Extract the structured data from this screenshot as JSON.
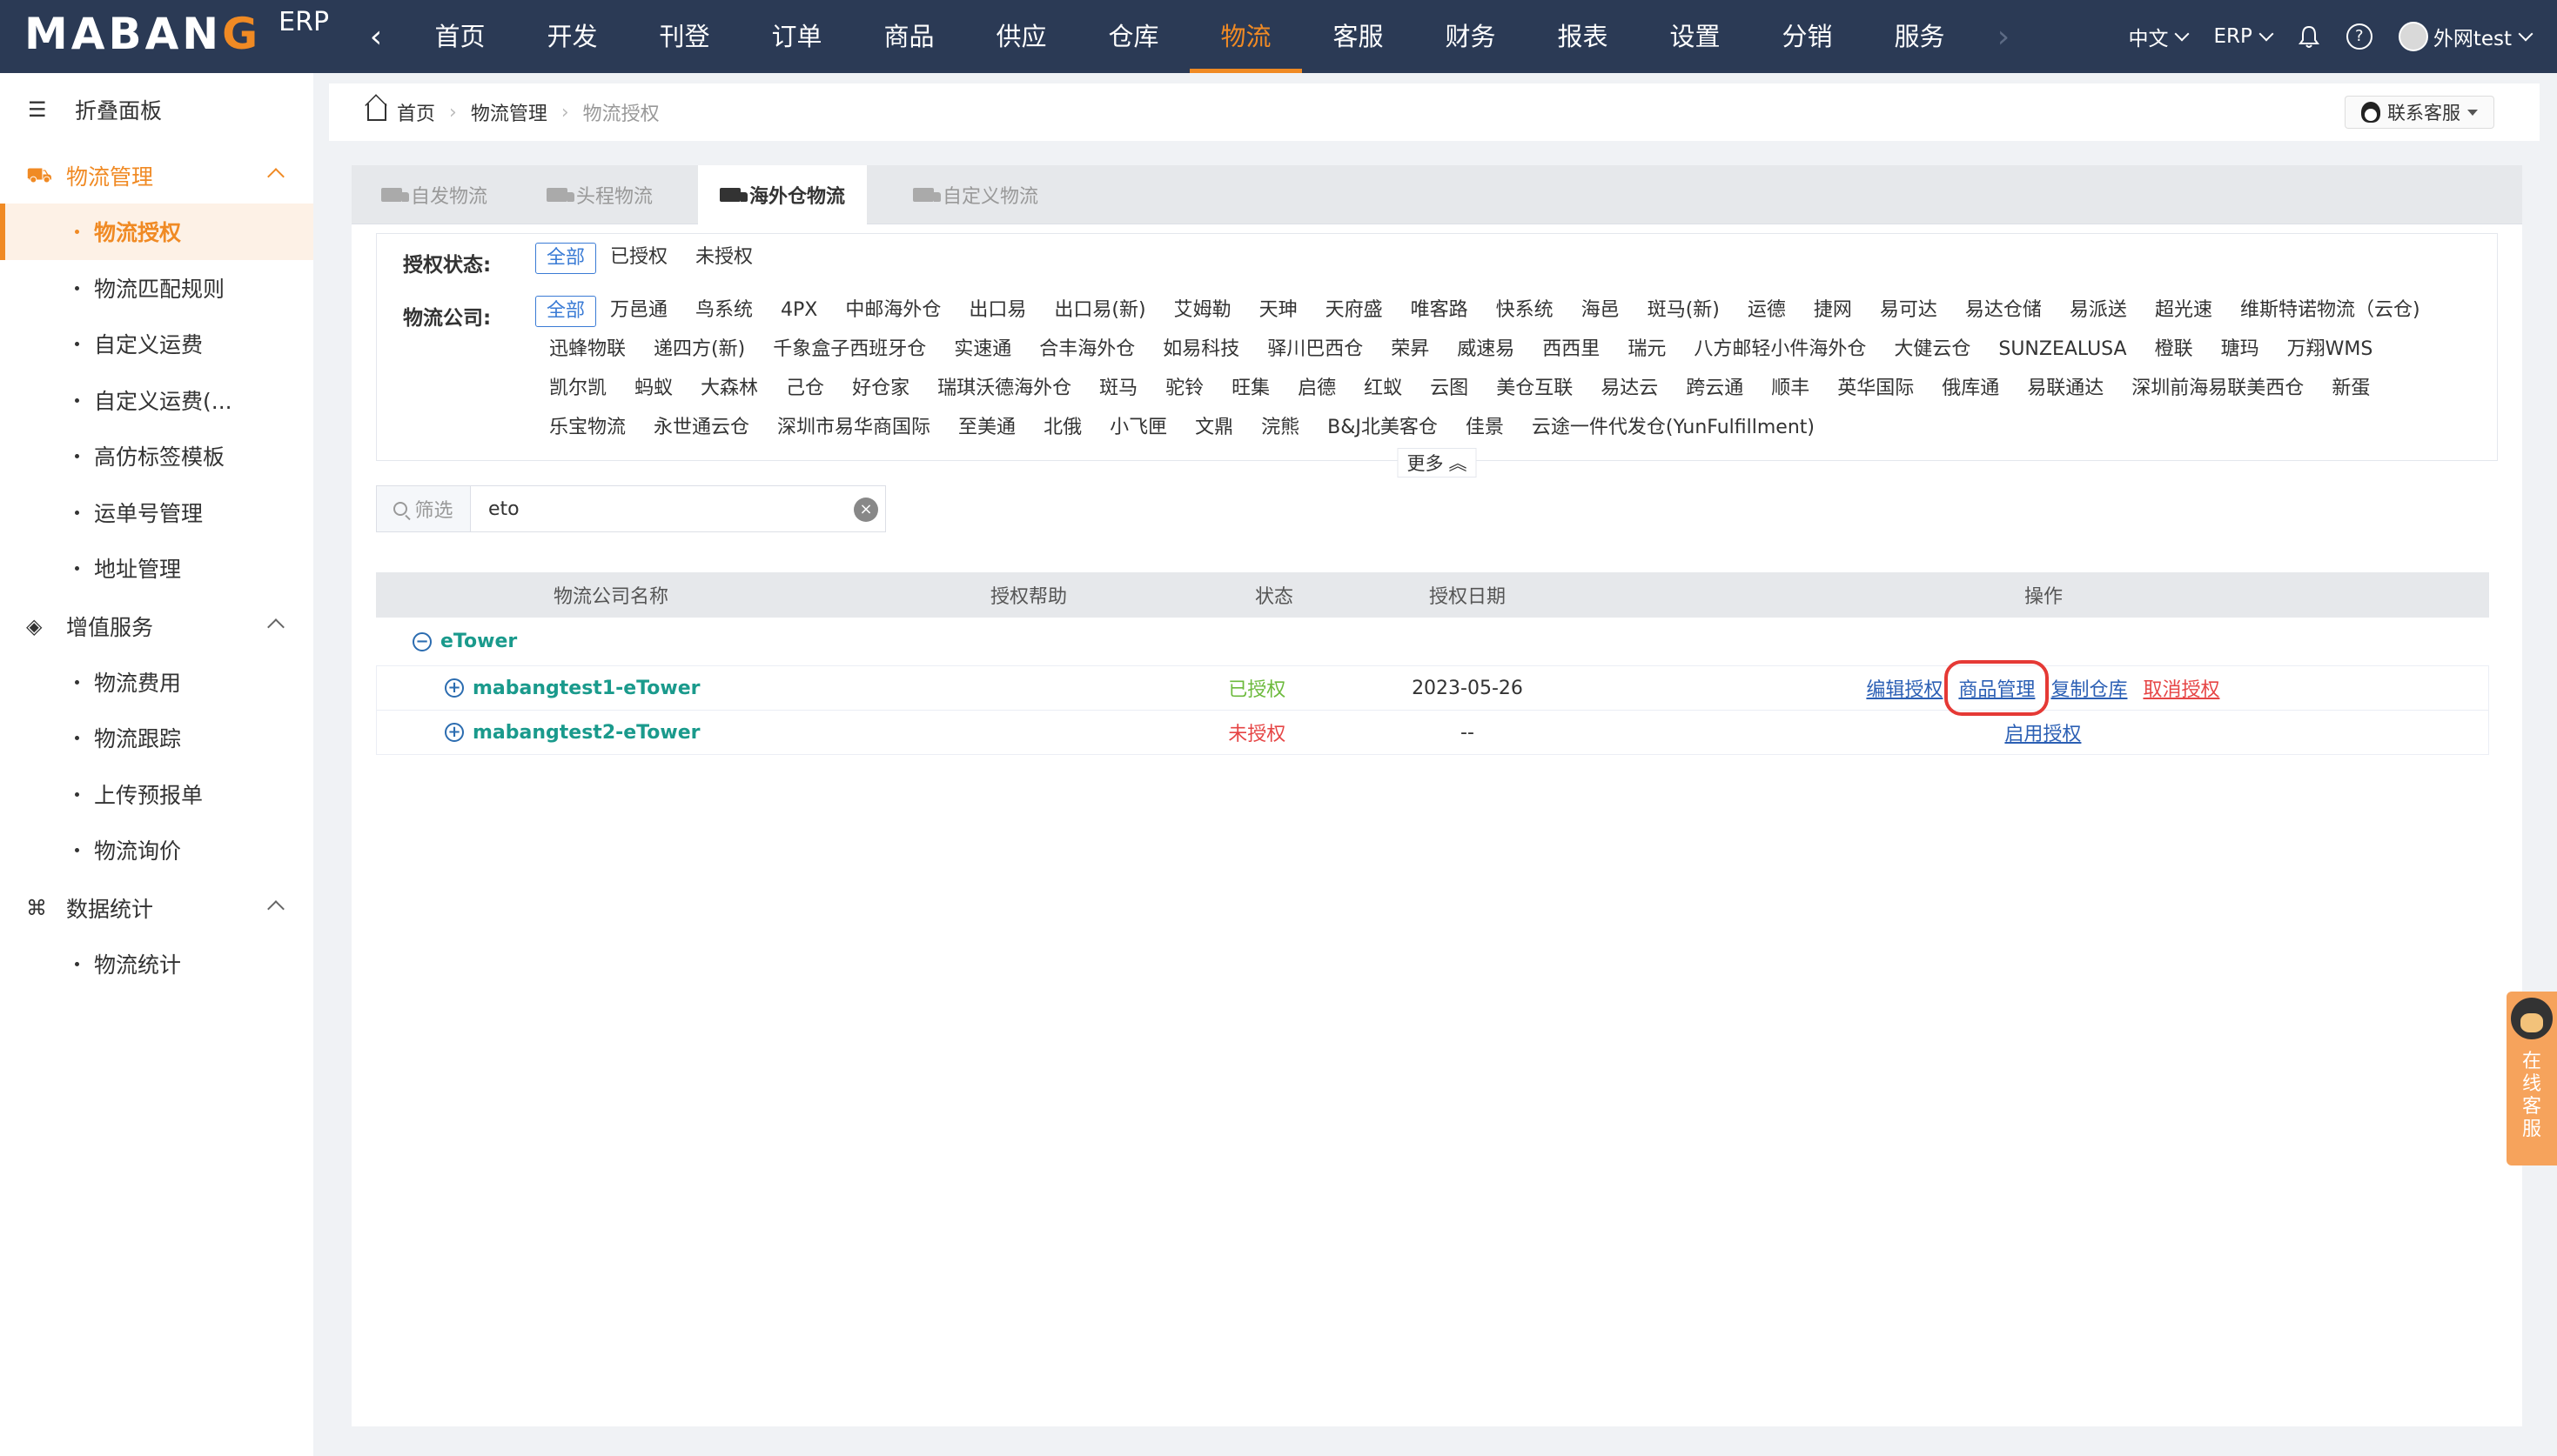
{
  "header": {
    "logo_main": "MABAN",
    "logo_g": "G",
    "logo_erp": "ERP",
    "nav": [
      "首页",
      "开发",
      "刊登",
      "订单",
      "商品",
      "供应链",
      "仓库",
      "物流",
      "客服",
      "财务",
      "报表",
      "设置",
      "分销",
      "服务"
    ],
    "active_nav": "物流",
    "lang": "中文",
    "erp_switch": "ERP",
    "user": "外网test"
  },
  "sidebar": {
    "collapse": "折叠面板",
    "group1": "物流管理",
    "group1_items": [
      "物流授权",
      "物流匹配规则",
      "自定义运费",
      "自定义运费(...",
      "高仿标签模板",
      "运单号管理",
      "地址管理"
    ],
    "group2": "增值服务",
    "group2_items": [
      "物流费用",
      "物流跟踪",
      "上传预报单",
      "物流询价"
    ],
    "group3": "数据统计",
    "group3_items": [
      "物流统计"
    ]
  },
  "breadcrumb": {
    "home": "首页",
    "level1": "物流管理",
    "level2": "物流授权",
    "contact": "联系客服"
  },
  "tabs": [
    "自发物流",
    "头程物流",
    "海外仓物流",
    "自定义物流"
  ],
  "filters": {
    "status_label": "授权状态:",
    "status_options": [
      "全部",
      "已授权",
      "未授权"
    ],
    "company_label": "物流公司:",
    "companies": [
      "全部",
      "万邑通",
      "鸟系统",
      "4PX",
      "中邮海外仓",
      "出口易",
      "出口易(新)",
      "艾姆勒",
      "天珅",
      "天府盛",
      "唯客路",
      "快系统",
      "海邑",
      "斑马(新)",
      "运德",
      "捷网",
      "易可达",
      "易达仓储",
      "易派送",
      "超光速",
      "维斯特诺物流（云仓)",
      "迅蜂物联",
      "递四方(新)",
      "千象盒子西班牙仓",
      "实速通",
      "合丰海外仓",
      "如易科技",
      "驿川巴西仓",
      "荣昇",
      "威速易",
      "西西里",
      "瑞元",
      "八方邮轻小件海外仓",
      "大健云仓",
      "SUNZEALUSA",
      "橙联",
      "瑭玛",
      "万翔WMS",
      "凯尔凯",
      "蚂蚁",
      "大森林",
      "己仓",
      "好仓家",
      "瑞琪沃德海外仓",
      "斑马",
      "驼铃",
      "旺集",
      "启德",
      "红蚁",
      "云图",
      "美仓互联",
      "易达云",
      "跨云通",
      "顺丰",
      "英华国际",
      "俄库通",
      "易联通达",
      "深圳前海易联美西仓",
      "新蛋",
      "乐宝物流",
      "永世通云仓",
      "深圳市易华商国际",
      "至美通",
      "北俄",
      "小飞匣",
      "文鼎",
      "浣熊",
      "B&J北美客仓",
      "佳景",
      "云途一件代发仓(YunFulfillment)"
    ],
    "more": "更多"
  },
  "search": {
    "label": "筛选",
    "value": "eto"
  },
  "table": {
    "headers": [
      "物流公司名称",
      "授权帮助",
      "状态",
      "授权日期",
      "操作"
    ],
    "group": "eTower",
    "rows": [
      {
        "name": "mabangtest1-eTower",
        "status": "已授权",
        "date": "2023-05-26",
        "ops": [
          "编辑授权",
          "商品管理",
          "复制仓库",
          "取消授权"
        ]
      },
      {
        "name": "mabangtest2-eTower",
        "status": "未授权",
        "date": "--",
        "ops": [
          "启用授权"
        ]
      }
    ]
  },
  "float_service": "在线客服",
  "colors": {
    "topbar": "#2b3a55",
    "accent": "#f08a24",
    "link": "#2b5fb4",
    "ok": "#6cba3c",
    "danger": "#e64545"
  }
}
